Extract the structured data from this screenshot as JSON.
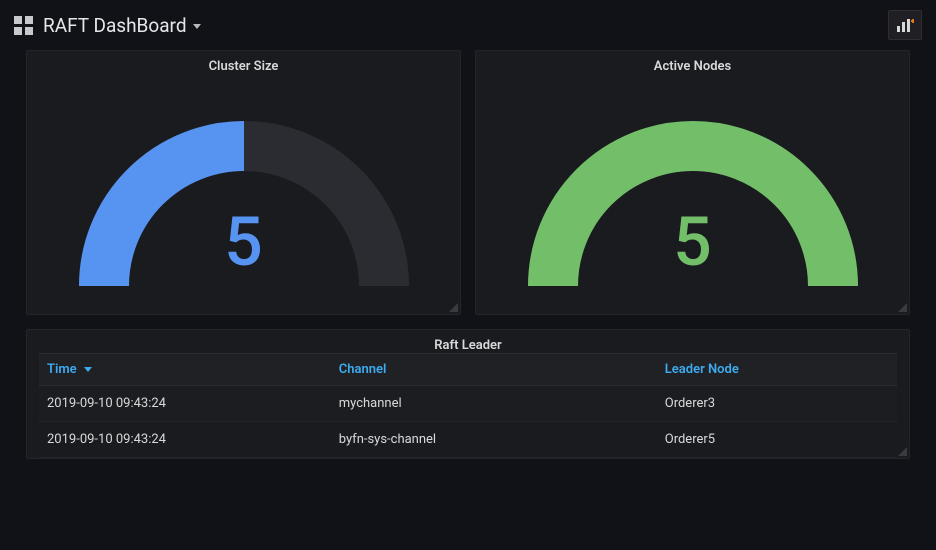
{
  "header": {
    "title": "RAFT DashBoard"
  },
  "panels": {
    "gauge1": {
      "title": "Cluster Size",
      "value": "5",
      "color": "#5794f2",
      "fill_fraction": 0.5
    },
    "gauge2": {
      "title": "Active Nodes",
      "value": "5",
      "color": "#73bf69",
      "fill_fraction": 1.0
    },
    "table": {
      "title": "Raft Leader",
      "columns": {
        "c1": "Time",
        "c2": "Channel",
        "c3": "Leader Node"
      },
      "rows": [
        {
          "time": "2019-09-10 09:43:24",
          "channel": "mychannel",
          "leader": "Orderer3"
        },
        {
          "time": "2019-09-10 09:43:24",
          "channel": "byfn-sys-channel",
          "leader": "Orderer5"
        }
      ]
    }
  },
  "chart_data": [
    {
      "type": "gauge",
      "title": "Cluster Size",
      "value": 5,
      "min": 0,
      "max": 10,
      "fraction": 0.5,
      "color": "#5794f2"
    },
    {
      "type": "gauge",
      "title": "Active Nodes",
      "value": 5,
      "min": 0,
      "max": 5,
      "fraction": 1.0,
      "color": "#73bf69"
    },
    {
      "type": "table",
      "title": "Raft Leader",
      "columns": [
        "Time",
        "Channel",
        "Leader Node"
      ],
      "rows": [
        [
          "2019-09-10 09:43:24",
          "mychannel",
          "Orderer3"
        ],
        [
          "2019-09-10 09:43:24",
          "byfn-sys-channel",
          "Orderer5"
        ]
      ]
    }
  ]
}
